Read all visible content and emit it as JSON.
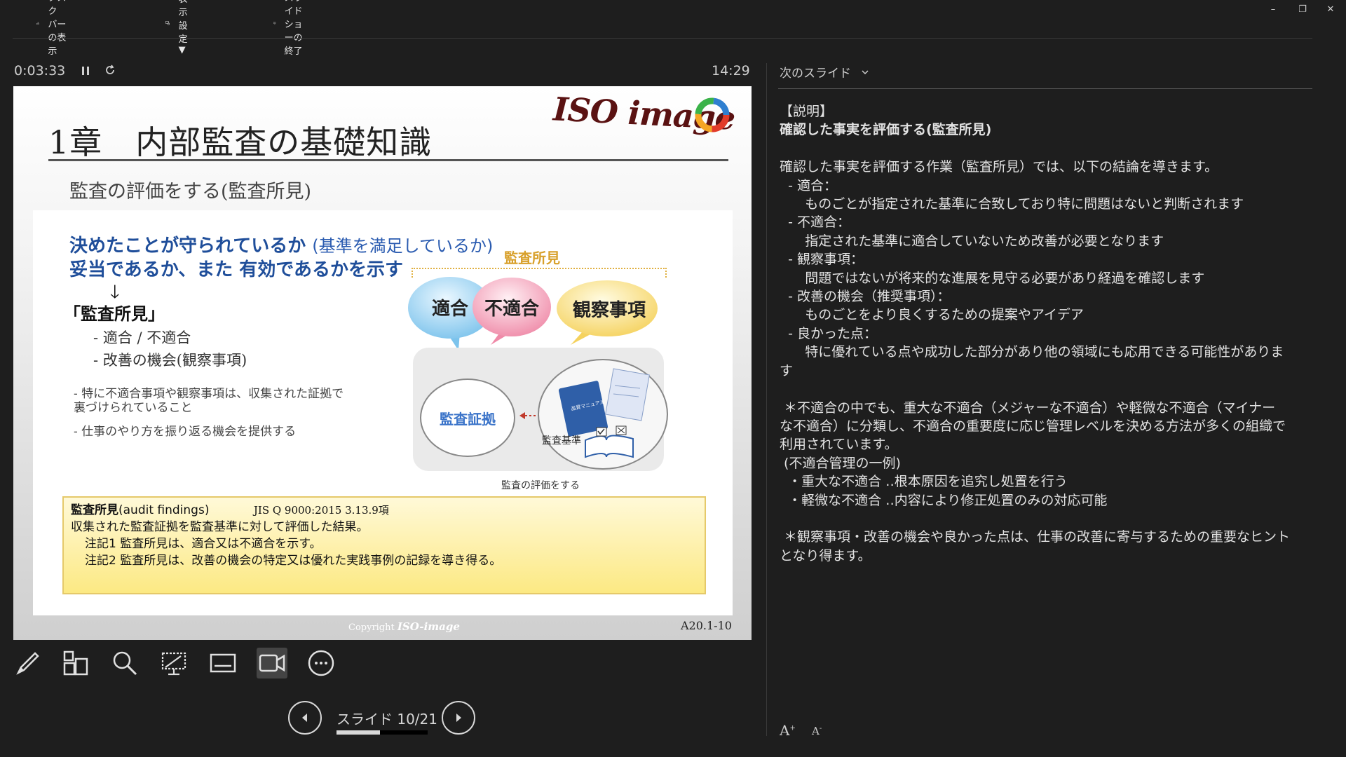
{
  "window": {
    "minimize_icon": "minimize-icon",
    "restore_icon": "restore-icon",
    "close_icon": "close-icon"
  },
  "toolbar": {
    "taskbar_label": "タスク バーの表示",
    "display_settings_label": "表示設定 ▼",
    "end_show_label": "スライド ショーの終了"
  },
  "status": {
    "elapsed": "0:03:33",
    "clock": "14:29"
  },
  "slide": {
    "title": "1章　内部監査の基礎知識",
    "logo_text": "ISO image",
    "subtitle": "監査の評価をする(監査所見)",
    "lead1_bold": "決めたことが守られているか",
    "lead1_sub": "(基準を満足しているか)",
    "lead2": "妥当であるか、また 有効であるかを示す",
    "arrow": "🡓",
    "finding_head": "「監査所見」",
    "bullets": [
      "-  適合 / 不適合",
      "-  改善の機会(観察事項)"
    ],
    "notes": [
      "- 特に不適合事項や観察事項は、収集された証拠で",
      "   裏づけられていること",
      "- 仕事のやり方を振り返る機会を提供する"
    ],
    "bubble_group_title": "監査所見",
    "bubbles": [
      "適合",
      "不適合",
      "観察事項"
    ],
    "evidence_label": "監査証拠",
    "standard_label": "監査基準",
    "manual_label": "品質マニュアル\n(QMS.xxx)",
    "eval_caption": "監査の評価をする",
    "definition": {
      "term": "監査所見",
      "term_en": "(audit findings)",
      "ref": "JIS Q 9000:2015 3.13.9項",
      "line1": "収集された監査証拠を監査基準に対して評価した結果。",
      "line2": "注記1 監査所見は、適合又は不適合を示す。",
      "line3": "注記2 監査所見は、改善の機会の特定又は優れた実践事例の記録を導き得る。"
    },
    "copyright": "Copyright",
    "copyright_logo": "ISO-image",
    "slide_code": "A20.1-10"
  },
  "tools": [
    {
      "name": "pen-tool-icon"
    },
    {
      "name": "see-all-slides-icon"
    },
    {
      "name": "zoom-icon"
    },
    {
      "name": "pointer-options-icon"
    },
    {
      "name": "subtitles-icon"
    },
    {
      "name": "camera-icon"
    },
    {
      "name": "more-options-icon"
    }
  ],
  "navigation": {
    "counter": "スライド 10/21",
    "current": 10,
    "total": 21
  },
  "notes_pane": {
    "next_slide_label": "次のスライド",
    "lines": [
      {
        "text": "【説明】",
        "bold": false
      },
      {
        "text": "確認した事実を評価する(監査所見)",
        "bold": true
      },
      {
        "text": "",
        "bold": false
      },
      {
        "text": "確認した事実を評価する作業（監査所見）では、以下の結論を導きます。",
        "bold": false
      },
      {
        "text": "  - 適合：",
        "bold": false
      },
      {
        "text": "      ものごとが指定された基準に合致しており特に問題はないと判断されます",
        "bold": false
      },
      {
        "text": "  - 不適合：",
        "bold": false
      },
      {
        "text": "      指定された基準に適合していないため改善が必要となります",
        "bold": false
      },
      {
        "text": "  - 観察事項：",
        "bold": false
      },
      {
        "text": "      問題ではないが将来的な進展を見守る必要があり経過を確認します",
        "bold": false
      },
      {
        "text": "  - 改善の機会（推奨事項）：",
        "bold": false
      },
      {
        "text": "      ものごとをより良くするための提案やアイデア",
        "bold": false
      },
      {
        "text": "  - 良かった点：",
        "bold": false
      },
      {
        "text": "      特に優れている点や成功した部分があり他の領域にも応用できる可能性がありま",
        "bold": false
      },
      {
        "text": "す",
        "bold": false
      },
      {
        "text": "",
        "bold": false
      },
      {
        "text": " ＊不適合の中でも、重大な不適合（メジャーな不適合）や軽微な不適合（マイナー",
        "bold": false
      },
      {
        "text": "な不適合）に分類し、不適合の重要度に応じ管理レベルを決める方法が多くの組織で",
        "bold": false
      },
      {
        "text": "利用されています。",
        "bold": false
      },
      {
        "text": " (不適合管理の一例)",
        "bold": false
      },
      {
        "text": "  ・重大な不適合 ‥根本原因を追究し処置を行う",
        "bold": false
      },
      {
        "text": "  ・軽微な不適合 ‥内容により修正処置のみの対応可能",
        "bold": false
      },
      {
        "text": "",
        "bold": false
      },
      {
        "text": " ＊観察事項・改善の機会や良かった点は、仕事の改善に寄与するための重要なヒント",
        "bold": false
      },
      {
        "text": "となり得ます。",
        "bold": false
      }
    ],
    "font_increase": "A",
    "font_decrease": "A"
  }
}
